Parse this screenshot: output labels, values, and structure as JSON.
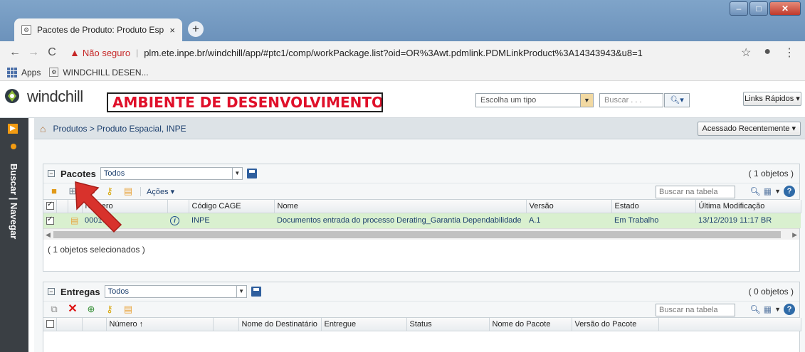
{
  "browser": {
    "tab_title": "Pacotes de Produto: Produto Esp",
    "tab_close": "×",
    "new_tab": "+",
    "back": "←",
    "forward": "→",
    "reload": "C",
    "insecure_label": "Não seguro",
    "url": "plm.ete.inpe.br/windchill/app/#ptc1/comp/workPackage.list?oid=OR%3Awt.pdmlink.PDMLinkProduct%3A14343943&u8=1",
    "star": "☆",
    "profile": "👤",
    "menu": "⋮",
    "bookmarks": {
      "apps": "Apps",
      "windchill": "WINDCHILL DESEN..."
    }
  },
  "header": {
    "logo_text": "windchill",
    "env_banner": "AMBIENTE DE DESENVOLVIMENTO",
    "type_select": "Escolha um tipo",
    "search_placeholder": "Buscar . . .",
    "quick_links": "Links Rápidos ▾"
  },
  "left_nav": {
    "label": "Buscar | Navegar"
  },
  "breadcrumb": {
    "path": "Produtos > Produto Espacial, INPE",
    "recent": "Acessado Recentemente ▾"
  },
  "pacotes": {
    "title": "Pacotes",
    "view": "Todos",
    "count": "( 1 objetos )",
    "actions": "Ações ▾",
    "search_placeholder": "Buscar na tabela",
    "columns": [
      "Número",
      "Código CAGE",
      "Nome",
      "Versão",
      "Estado",
      "Última Modificação"
    ],
    "rows": [
      {
        "numero": "000167",
        "cage": "INPE",
        "nome": "Documentos entrada do processo Derating_Garantia Dependabilidade",
        "versao": "A.1",
        "estado": "Em Trabalho",
        "modificacao": "13/12/2019 11:17 BR"
      }
    ],
    "selected": "( 1 objetos selecionados )"
  },
  "entregas": {
    "title": "Entregas",
    "view": "Todos",
    "count": "( 0 objetos )",
    "search_placeholder": "Buscar na tabela",
    "columns": [
      "Número ↑",
      "Nome do Destinatário",
      "Entregue",
      "Status",
      "Nome do Pacote",
      "Versão do Pacote"
    ]
  },
  "colors": {
    "env_red": "#e0102a",
    "selected_row": "#d9f0cf",
    "nav_dark": "#3a3f44",
    "accent_orange": "#f29b12"
  }
}
